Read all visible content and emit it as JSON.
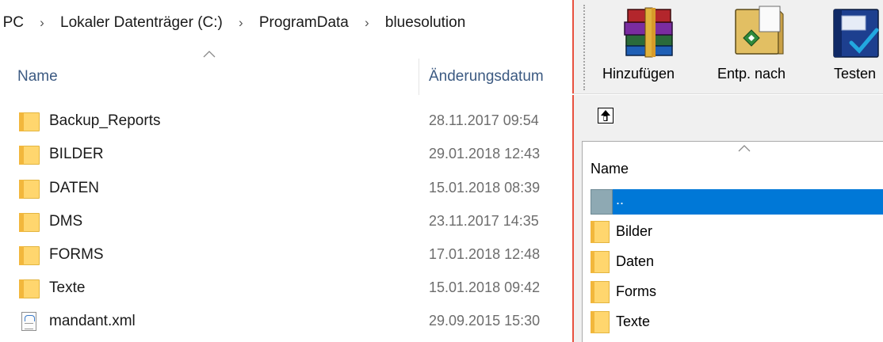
{
  "explorer": {
    "breadcrumb": [
      "r PC",
      "Lokaler Datenträger (C:)",
      "ProgramData",
      "bluesolution"
    ],
    "breadcrumb_separator": "›",
    "columns": {
      "name": "Name",
      "date": "Änderungsdatum"
    },
    "files": [
      {
        "name": "Backup_Reports",
        "date": "28.11.2017 09:54",
        "type": "folder"
      },
      {
        "name": "BILDER",
        "date": "29.01.2018 12:43",
        "type": "folder"
      },
      {
        "name": "DATEN",
        "date": "15.01.2018 08:39",
        "type": "folder"
      },
      {
        "name": "DMS",
        "date": "23.11.2017 14:35",
        "type": "folder"
      },
      {
        "name": "FORMS",
        "date": "17.01.2018 12:48",
        "type": "folder"
      },
      {
        "name": "Texte",
        "date": "15.01.2018 09:42",
        "type": "folder"
      },
      {
        "name": "mandant.xml",
        "date": "29.09.2015 15:30",
        "type": "xml-file"
      }
    ]
  },
  "winrar": {
    "toolbar": [
      {
        "label": "Hinzufügen",
        "icon": "archive-books-icon"
      },
      {
        "label": "Entp. nach",
        "icon": "extract-folder-icon"
      },
      {
        "label": "Testen",
        "icon": "test-book-icon"
      }
    ],
    "columns": {
      "name": "Name"
    },
    "entries": [
      {
        "name": "..",
        "selected": true,
        "type": "parent"
      },
      {
        "name": "Bilder",
        "type": "folder"
      },
      {
        "name": "Daten",
        "type": "folder"
      },
      {
        "name": "Forms",
        "type": "folder"
      },
      {
        "name": "Texte",
        "type": "folder"
      }
    ]
  },
  "colors": {
    "selection": "#0078d7",
    "folder": "#ffd66e",
    "window_edge": "#e8513f",
    "header_text": "#3c5a82",
    "date_text": "#6d6d6d"
  }
}
